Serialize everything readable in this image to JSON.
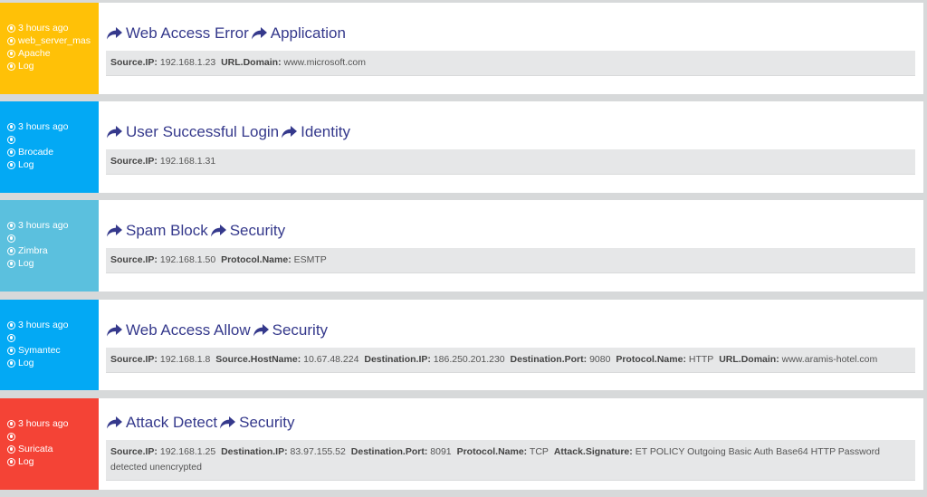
{
  "colors": {
    "title": "#35398c",
    "card_1": "#ffc107",
    "card_2": "#03a9f4",
    "card_3": "#5bc0de",
    "card_4": "#03a9f4",
    "card_5": "#f44336"
  },
  "events": [
    {
      "side_color": "#ffc107",
      "meta": {
        "time": "3 hours ago",
        "host": "web_server_mas",
        "source": "Apache",
        "type": "Log"
      },
      "title": "Web Access Error",
      "category": "Application",
      "fields": [
        {
          "key": "Source.IP:",
          "value": "192.168.1.23"
        },
        {
          "key": "URL.Domain:",
          "value": "www.microsoft.com"
        }
      ]
    },
    {
      "side_color": "#03a9f4",
      "meta": {
        "time": "3 hours ago",
        "host": "",
        "source": "Brocade",
        "type": "Log"
      },
      "title": "User Successful Login",
      "category": "Identity",
      "fields": [
        {
          "key": "Source.IP:",
          "value": "192.168.1.31"
        }
      ]
    },
    {
      "side_color": "#5bc0de",
      "meta": {
        "time": "3 hours ago",
        "host": "",
        "source": "Zimbra",
        "type": "Log"
      },
      "title": "Spam Block",
      "category": "Security",
      "fields": [
        {
          "key": "Source.IP:",
          "value": "192.168.1.50"
        },
        {
          "key": "Protocol.Name:",
          "value": "ESMTP"
        }
      ]
    },
    {
      "side_color": "#03a9f4",
      "meta": {
        "time": "3 hours ago",
        "host": "",
        "source": "Symantec",
        "type": "Log"
      },
      "title": "Web Access Allow",
      "category": "Security",
      "fields": [
        {
          "key": "Source.IP:",
          "value": "192.168.1.8"
        },
        {
          "key": "Source.HostName:",
          "value": "10.67.48.224"
        },
        {
          "key": "Destination.IP:",
          "value": "186.250.201.230"
        },
        {
          "key": "Destination.Port:",
          "value": "9080"
        },
        {
          "key": "Protocol.Name:",
          "value": "HTTP"
        },
        {
          "key": "URL.Domain:",
          "value": "www.aramis-hotel.com"
        }
      ]
    },
    {
      "side_color": "#f44336",
      "meta": {
        "time": "3 hours ago",
        "host": "",
        "source": "Suricata",
        "type": "Log"
      },
      "title": "Attack Detect",
      "category": "Security",
      "fields": [
        {
          "key": "Source.IP:",
          "value": "192.168.1.25"
        },
        {
          "key": "Destination.IP:",
          "value": "83.97.155.52"
        },
        {
          "key": "Destination.Port:",
          "value": "8091"
        },
        {
          "key": "Protocol.Name:",
          "value": "TCP"
        },
        {
          "key": "Attack.Signature:",
          "value": "ET POLICY Outgoing Basic Auth Base64 HTTP Password detected unencrypted"
        }
      ]
    }
  ]
}
